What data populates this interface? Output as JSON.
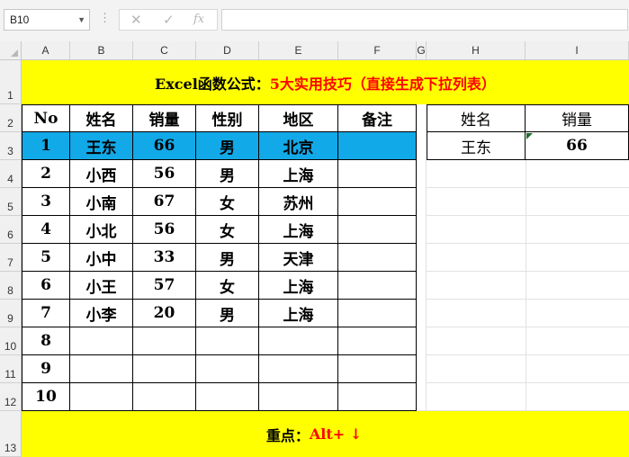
{
  "formula_bar": {
    "name_box": "B10",
    "cancel_icon": "✕",
    "enter_icon": "✓",
    "fx_icon": "fx",
    "formula": ""
  },
  "columns": [
    "A",
    "B",
    "C",
    "D",
    "E",
    "F",
    "G",
    "H",
    "I"
  ],
  "rows": [
    "1",
    "2",
    "3",
    "4",
    "5",
    "6",
    "7",
    "8",
    "9",
    "10",
    "11",
    "12",
    "13"
  ],
  "title": {
    "part1": "Excel函数公式：",
    "part2": "5大实用技巧（直接生成下拉列表）",
    "color1": "#000000",
    "color2": "#ff0000"
  },
  "table": {
    "headers": [
      "No",
      "姓名",
      "销量",
      "性别",
      "地区",
      "备注"
    ],
    "rows": [
      [
        "1",
        "王东",
        "66",
        "男",
        "北京",
        ""
      ],
      [
        "2",
        "小西",
        "56",
        "男",
        "上海",
        ""
      ],
      [
        "3",
        "小南",
        "67",
        "女",
        "苏州",
        ""
      ],
      [
        "4",
        "小北",
        "56",
        "女",
        "上海",
        ""
      ],
      [
        "5",
        "小中",
        "33",
        "男",
        "天津",
        ""
      ],
      [
        "6",
        "小王",
        "57",
        "女",
        "上海",
        ""
      ],
      [
        "7",
        "小李",
        "20",
        "男",
        "上海",
        ""
      ],
      [
        "8",
        "",
        "",
        "",
        "",
        ""
      ],
      [
        "9",
        "",
        "",
        "",
        "",
        ""
      ],
      [
        "10",
        "",
        "",
        "",
        "",
        ""
      ]
    ],
    "highlight_color": "#12a9e8"
  },
  "lookup": {
    "headers": [
      "姓名",
      "销量"
    ],
    "values": [
      "王东",
      "66"
    ]
  },
  "footer": {
    "part1": "重点：",
    "part2": "Alt+ ↓"
  },
  "colors": {
    "banner": "#ffff00",
    "accent_red": "#ff0000"
  }
}
